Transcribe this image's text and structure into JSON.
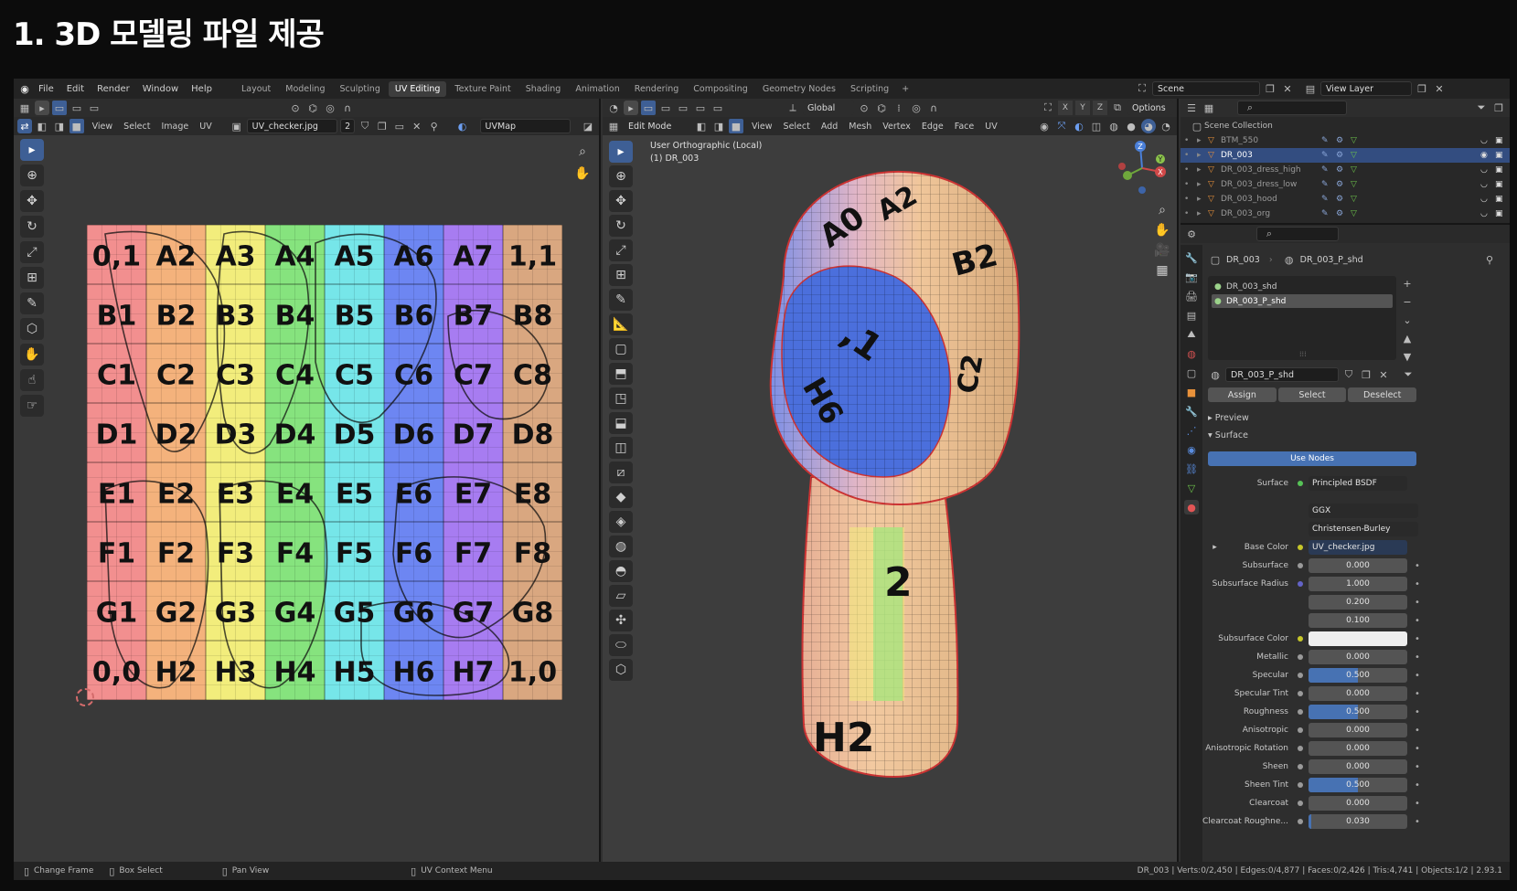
{
  "slide_title": "1. 3D 모델링 파일 제공",
  "menus": [
    "File",
    "Edit",
    "Render",
    "Window",
    "Help"
  ],
  "workspaces": [
    {
      "label": "Layout",
      "active": false
    },
    {
      "label": "Modeling",
      "active": false
    },
    {
      "label": "Sculpting",
      "active": false
    },
    {
      "label": "UV Editing",
      "active": true
    },
    {
      "label": "Texture Paint",
      "active": false
    },
    {
      "label": "Shading",
      "active": false
    },
    {
      "label": "Animation",
      "active": false
    },
    {
      "label": "Rendering",
      "active": false
    },
    {
      "label": "Compositing",
      "active": false
    },
    {
      "label": "Geometry Nodes",
      "active": false
    },
    {
      "label": "Scripting",
      "active": false
    }
  ],
  "add_workspace": "+",
  "scene": "Scene",
  "view_layer": "View Layer",
  "uv_editor": {
    "menus": [
      "View",
      "Select",
      "Image",
      "UV"
    ],
    "image_name": "UV_checker.jpg",
    "users": "2",
    "uvmap": "UVMap",
    "grid_rows": [
      [
        "0,1",
        "A2",
        "A3",
        "A4",
        "A5",
        "A6",
        "A7",
        "1,1"
      ],
      [
        "B1",
        "B2",
        "B3",
        "B4",
        "B5",
        "B6",
        "B7",
        "B8"
      ],
      [
        "C1",
        "C2",
        "C3",
        "C4",
        "C5",
        "C6",
        "C7",
        "C8"
      ],
      [
        "D1",
        "D2",
        "D3",
        "D4",
        "D5",
        "D6",
        "D7",
        "D8"
      ],
      [
        "E1",
        "E2",
        "E3",
        "E4",
        "E5",
        "E6",
        "E7",
        "E8"
      ],
      [
        "F1",
        "F2",
        "F3",
        "F4",
        "F5",
        "F6",
        "F7",
        "F8"
      ],
      [
        "G1",
        "G2",
        "G3",
        "G4",
        "G5",
        "G6",
        "G7",
        "G8"
      ],
      [
        "0,0",
        "H2",
        "H3",
        "H4",
        "H5",
        "H6",
        "H7",
        "1,0"
      ]
    ],
    "column_colors": [
      "#f28f8f",
      "#f4b27c",
      "#f2ed7c",
      "#86e37e",
      "#76e6e9",
      "#6d86f2",
      "#a77cf1",
      "#d9a780"
    ]
  },
  "viewport": {
    "mode": "Edit Mode",
    "menus": [
      "View",
      "Select",
      "Add",
      "Mesh",
      "Vertex",
      "Edge",
      "Face",
      "UV"
    ],
    "orientation": "Global",
    "options": "Options",
    "view_label": "User Orthographic (Local)",
    "object_label": "(1) DR_003",
    "axes": {
      "x": "X",
      "y": "Y",
      "z": "Z"
    }
  },
  "outliner": {
    "header": "Scene Collection",
    "items": [
      {
        "name": "BTM_550",
        "selected": false
      },
      {
        "name": "DR_003",
        "selected": true
      },
      {
        "name": "DR_003_dress_high",
        "selected": false
      },
      {
        "name": "DR_003_dress_low",
        "selected": false
      },
      {
        "name": "DR_003_hood",
        "selected": false
      },
      {
        "name": "DR_003_org",
        "selected": false
      }
    ]
  },
  "properties": {
    "object_name": "DR_003",
    "material_name": "DR_003_P_shd",
    "slots": [
      {
        "name": "DR_003_shd",
        "selected": false
      },
      {
        "name": "DR_003_P_shd",
        "selected": true
      }
    ],
    "slot_field": "DR_003_P_shd",
    "buttons": {
      "assign": "Assign",
      "select": "Select",
      "deselect": "Deselect"
    },
    "preview": "Preview",
    "surface": "Surface",
    "use_nodes": "Use Nodes",
    "surface_label": "Surface",
    "surface_shader": "Principled BSDF",
    "distribution": "GGX",
    "sss_method": "Christensen-Burley",
    "base_color_label": "Base Color",
    "base_color_value": "UV_checker.jpg",
    "rows": [
      {
        "label": "Subsurface",
        "value": "0.000",
        "fill": 0
      },
      {
        "label": "Subsurface Radius",
        "value": "1.000",
        "fill": 0
      },
      {
        "label": "",
        "value": "0.200",
        "fill": 0
      },
      {
        "label": "",
        "value": "0.100",
        "fill": 0
      },
      {
        "label": "Subsurface Color",
        "value": "",
        "fill": 0,
        "swatch": "#eeeeee"
      },
      {
        "label": "Metallic",
        "value": "0.000",
        "fill": 0
      },
      {
        "label": "Specular",
        "value": "0.500",
        "fill": 0.5
      },
      {
        "label": "Specular Tint",
        "value": "0.000",
        "fill": 0
      },
      {
        "label": "Roughness",
        "value": "0.500",
        "fill": 0.5
      },
      {
        "label": "Anisotropic",
        "value": "0.000",
        "fill": 0
      },
      {
        "label": "Anisotropic Rotation",
        "value": "0.000",
        "fill": 0
      },
      {
        "label": "Sheen",
        "value": "0.000",
        "fill": 0
      },
      {
        "label": "Sheen Tint",
        "value": "0.500",
        "fill": 0.5
      },
      {
        "label": "Clearcoat",
        "value": "0.000",
        "fill": 0
      },
      {
        "label": "Clearcoat Roughne...",
        "value": "0.030",
        "fill": 0.03
      }
    ]
  },
  "statusbar": {
    "change_frame": "Change Frame",
    "box_select": "Box Select",
    "pan_view": "Pan View",
    "uv_context_menu": "UV Context Menu",
    "stats": "DR_003 | Verts:0/2,450 | Edges:0/4,877 | Faces:0/2,426 | Tris:4,741 | Objects:1/2 | 2.93.1"
  }
}
